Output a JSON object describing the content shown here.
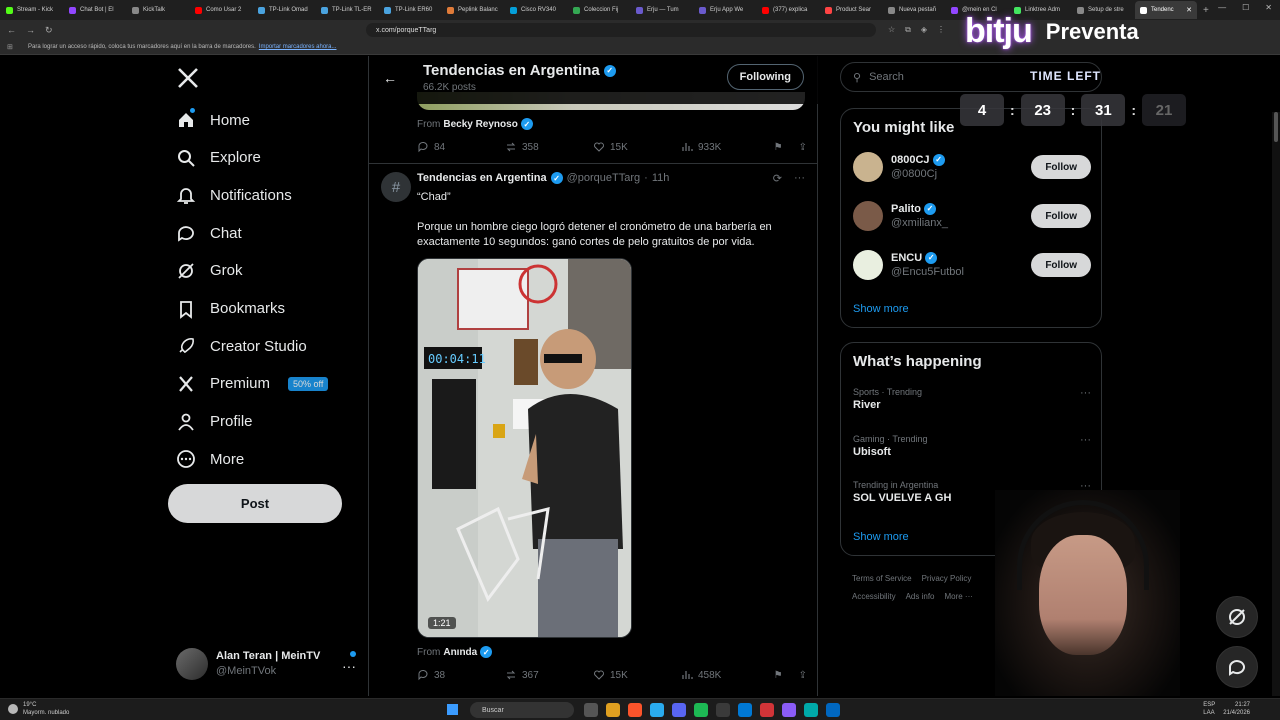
{
  "browser": {
    "tabs": [
      {
        "label": "Stream - Kick",
        "color": "#53fc18"
      },
      {
        "label": "Chat Bot | El",
        "color": "#9146ff"
      },
      {
        "label": "KickTalk",
        "color": "#888888"
      },
      {
        "label": "Como Usar 2",
        "color": "#ff0000"
      },
      {
        "label": "TP-Link Omad",
        "color": "#4aa3df"
      },
      {
        "label": "TP-Link TL-ER",
        "color": "#4aa3df"
      },
      {
        "label": "TP-Link ER60",
        "color": "#4aa3df"
      },
      {
        "label": "Peplink Balanc",
        "color": "#e07b39"
      },
      {
        "label": "Cisco RV340",
        "color": "#049fd9"
      },
      {
        "label": "Coleccion Fij",
        "color": "#34a853"
      },
      {
        "label": "Erju — Tum",
        "color": "#6a5acd"
      },
      {
        "label": "Erju App We",
        "color": "#6a5acd"
      },
      {
        "label": "(377) explica",
        "color": "#ff0000"
      },
      {
        "label": "Product Sear",
        "color": "#ff4444"
      },
      {
        "label": "Nueva pestañ",
        "color": "#888888"
      },
      {
        "label": "@mein en Cl",
        "color": "#9146ff"
      },
      {
        "label": "Linktree Adm",
        "color": "#43e660"
      },
      {
        "label": "Setup de stre",
        "color": "#888888"
      },
      {
        "label": "Tendenc",
        "color": "#ffffff",
        "active": true
      }
    ],
    "url": "x.com/porqueTTarg",
    "bookmarks_hint": "Para lograr un acceso rápido, coloca tus marcadores aquí en la barra de marcadores.",
    "bookmarks_link": "Importar marcadores ahora..."
  },
  "nav": {
    "items": [
      {
        "label": "Home",
        "icon": "home-icon"
      },
      {
        "label": "Explore",
        "icon": "search-icon"
      },
      {
        "label": "Notifications",
        "icon": "bell-icon"
      },
      {
        "label": "Chat",
        "icon": "chat-icon"
      },
      {
        "label": "Grok",
        "icon": "grok-icon"
      },
      {
        "label": "Bookmarks",
        "icon": "bookmark-icon"
      },
      {
        "label": "Creator Studio",
        "icon": "rocket-icon"
      },
      {
        "label": "Premium",
        "icon": "x-icon"
      },
      {
        "label": "Profile",
        "icon": "person-icon"
      },
      {
        "label": "More",
        "icon": "more-circle-icon"
      }
    ],
    "premium_badge": "50% off",
    "post_label": "Post",
    "account": {
      "name": "Alan Teran | MeinTV",
      "handle": "@MeinTVok"
    }
  },
  "header": {
    "title": "Tendencias en Argentina",
    "subtitle": "66.2K posts",
    "following_label": "Following"
  },
  "prev_post": {
    "from_label": "From",
    "from_name": "Becky Reynoso",
    "replies": "84",
    "reposts": "358",
    "likes": "15K",
    "views": "933K"
  },
  "post": {
    "name": "Tendencias en Argentina",
    "handle": "@porqueTTarg",
    "time": "11h",
    "quote": "“Chad”",
    "text": "Porque un hombre ciego logró detener el cronómetro de una barbería en exactamente 10 segundos: ganó cortes de pelo gratuitos de por vida.",
    "media_duration": "1:21",
    "clock_display": "00:04:11",
    "from_label": "From",
    "from_name": "Anında",
    "replies": "38",
    "reposts": "367",
    "likes": "15K",
    "views": "458K"
  },
  "right": {
    "search_placeholder": "Search",
    "you_might_like": "You might like",
    "suggestions": [
      {
        "name": "0800CJ",
        "handle": "@0800Cj",
        "color": "#c9b38f"
      },
      {
        "name": "Palito",
        "handle": "@xmilianx_",
        "color": "#7a5a48"
      },
      {
        "name": "ENCU",
        "handle": "@Encu5Futbol",
        "color": "#e9efe0"
      }
    ],
    "follow_label": "Follow",
    "show_more": "Show more",
    "whats_happening": "What’s happening",
    "trends": [
      {
        "meta": "Sports · Trending",
        "name": "River"
      },
      {
        "meta": "Gaming · Trending",
        "name": "Ubisoft"
      },
      {
        "meta": "Trending in Argentina",
        "name": "SOL VUELVE A GH"
      }
    ],
    "footer": [
      "Terms of Service",
      "Privacy Policy",
      "Accessibility",
      "Ads info",
      "More ···"
    ]
  },
  "overlay": {
    "brand": "bitju",
    "tagline": "Preventa",
    "time_left": "TIME LEFT",
    "timer": [
      "4",
      "23",
      "31",
      "21"
    ]
  },
  "taskbar": {
    "temp": "19°C",
    "weather": "Mayorm. nublado",
    "search": "Buscar",
    "lang": "ESP",
    "layout": "LAA",
    "time": "21:27",
    "date": "21/4/2026"
  }
}
